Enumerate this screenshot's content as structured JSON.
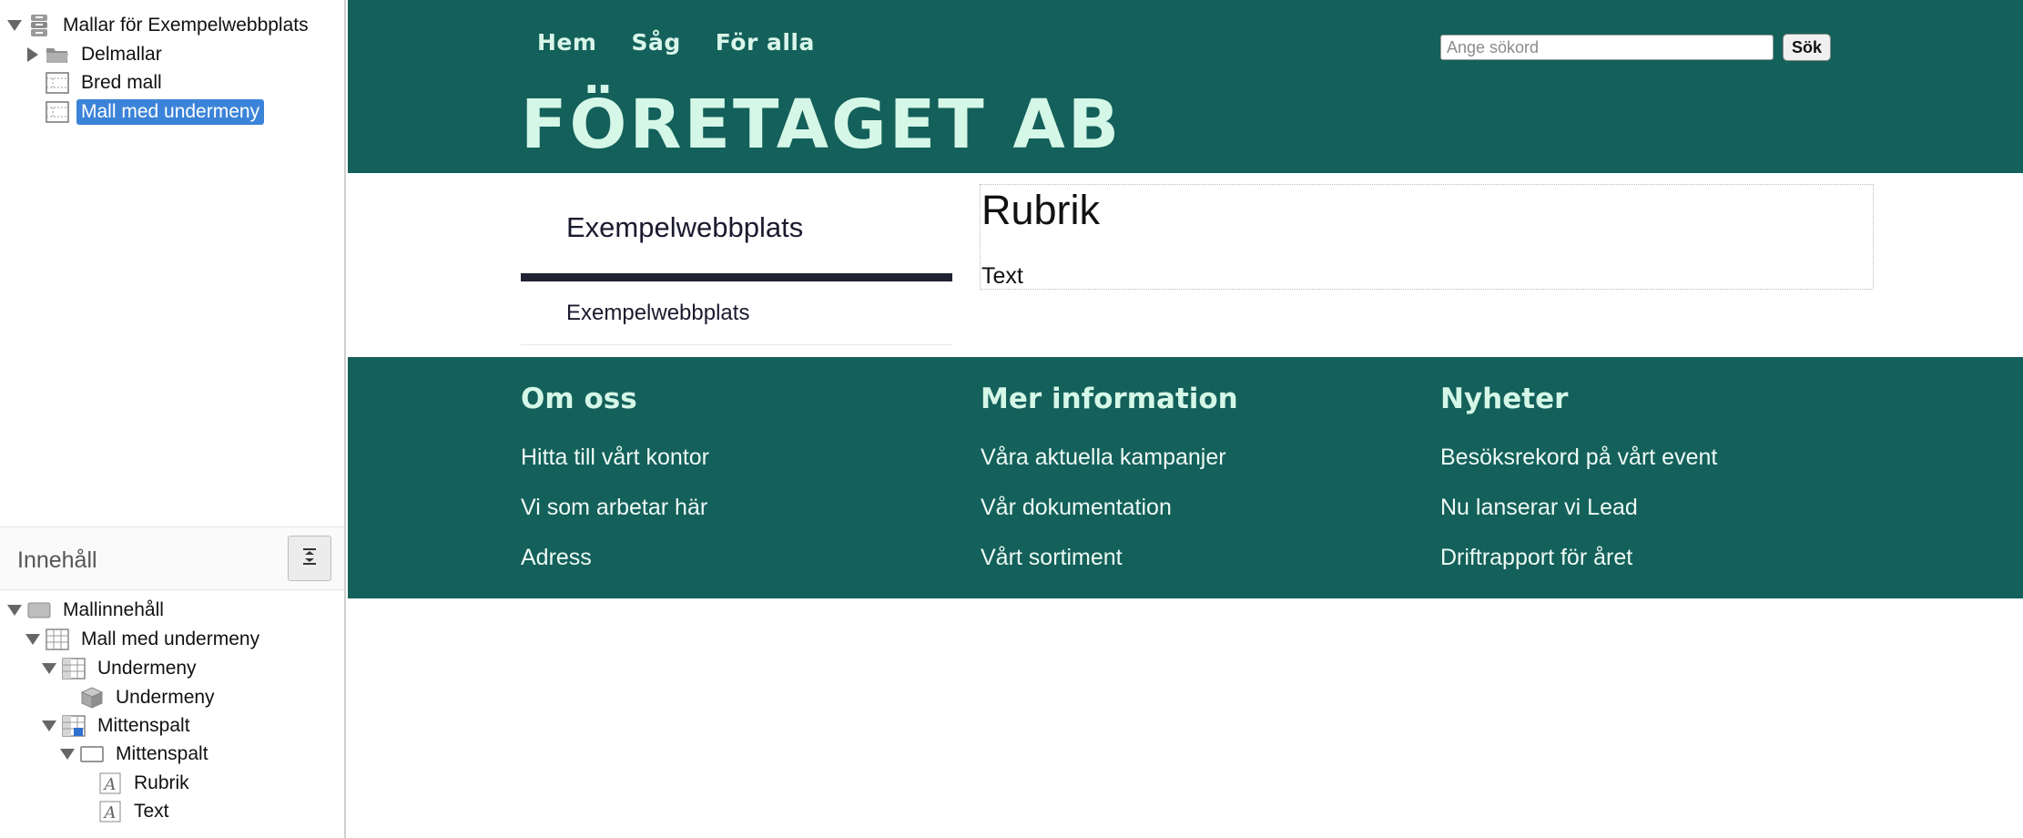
{
  "template_tree": {
    "root": "Mallar för Exempelwebbplats",
    "items": [
      "Delmallar",
      "Bred mall",
      "Mall med undermeny"
    ]
  },
  "content_panel": {
    "title": "Innehåll",
    "tree": [
      "Mallinnehåll",
      "Mall med undermeny",
      "Undermeny",
      "Undermeny",
      "Mittenspalt",
      "Mittenspalt",
      "Rubrik",
      "Text"
    ]
  },
  "site": {
    "nav": [
      "Hem",
      "Såg",
      "För alla"
    ],
    "search": {
      "placeholder": "Ange sökord",
      "button": "Sök"
    },
    "brand": "FÖRETAGET AB",
    "submenu": {
      "heading": "Exempelwebbplats",
      "item": "Exempelwebbplats"
    },
    "content": {
      "heading": "Rubrik",
      "text": "Text"
    },
    "footer": [
      {
        "heading": "Om oss",
        "links": [
          "Hitta till vårt kontor",
          "Vi som arbetar här",
          "Adress"
        ]
      },
      {
        "heading": "Mer information",
        "links": [
          "Våra aktuella kampanjer",
          "Vår dokumentation",
          "Vårt sortiment"
        ]
      },
      {
        "heading": "Nyheter",
        "links": [
          "Besöksrekord på vårt event",
          "Nu lanserar vi Lead",
          "Driftrapport för året"
        ]
      }
    ]
  },
  "colors": {
    "site_green": "#14605a",
    "brand_text": "#d5f7e8",
    "selection": "#3b83d8"
  }
}
